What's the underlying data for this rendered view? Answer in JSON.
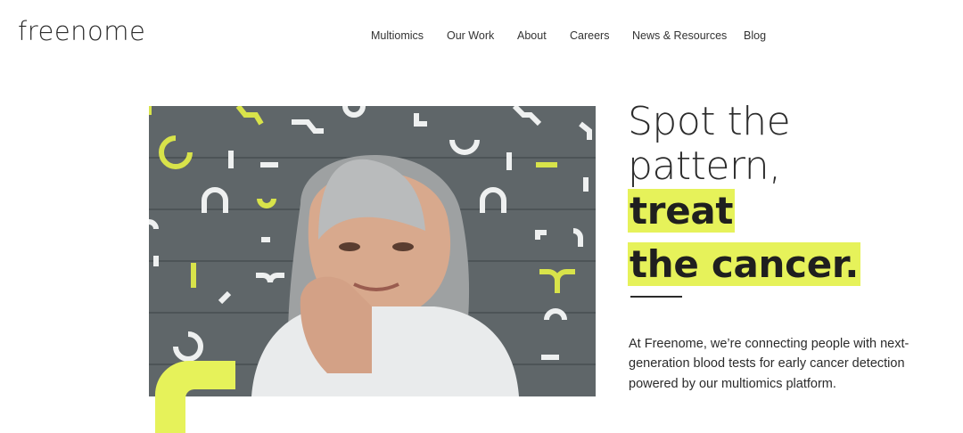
{
  "brand": {
    "logo_text": "freenome",
    "accent_color": "#e6f25a",
    "text_color": "#2b2b2b"
  },
  "nav": {
    "items": [
      {
        "label": "Multiomics"
      },
      {
        "label": "Our Work"
      },
      {
        "label": "About"
      },
      {
        "label": "Careers"
      },
      {
        "label": "News & Resources"
      },
      {
        "label": "Blog"
      }
    ]
  },
  "hero": {
    "headline_line1": "Spot the",
    "headline_line2": "pattern,",
    "headline_line3": "treat",
    "headline_line4": "the cancer.",
    "description": "At Freenome, we’re connecting people with next-generation blood tests for early cancer detection powered by our multiomics platform."
  }
}
